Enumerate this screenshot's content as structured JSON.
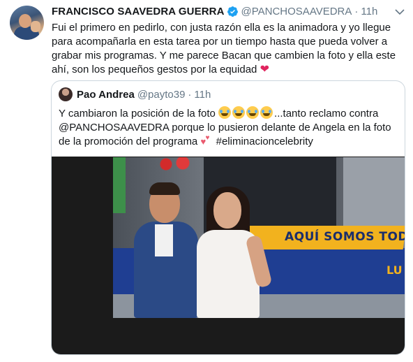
{
  "tweet": {
    "author_name": "FRANCISCO SAAVEDRA GUERRA",
    "handle": "@PANCHOSAAVEDRA",
    "separator": "·",
    "time": "11h",
    "verified_icon": "verified-badge-icon",
    "text_lines": [
      "Fui el primero en pedirlo, con justa razón ella es la animadora y yo llegue",
      "para acompañarla en esta tarea por un tiempo hasta que pueda volver a",
      "grabar mis programas. Y me parece Bacan que cambien la foto y ella este",
      "ahí, son los pequeños gestos por la equidad"
    ],
    "heart_emoji": "❤"
  },
  "quoted_tweet": {
    "author_name": "Pao Andrea",
    "handle": "@payto39",
    "separator": "·",
    "time": "11h",
    "text_line1_prefix": "Y cambiaron la posición de la foto",
    "text_line1_suffix": "...tanto reclamo contra",
    "text_line2": "@PANCHOSAAVEDRA porque lo pusieron delante de Angela en la foto",
    "text_line3_prefix": "de la promoción del programa",
    "text_line3_suffix": "#eliminacioncelebrity",
    "emoji_count": 4
  },
  "media": {
    "tagline": "AQUÍ SOMOS TODOS",
    "corner_text": "LU"
  },
  "colors": {
    "text": "#14171a",
    "secondary": "#657786",
    "verified": "#1da1f2",
    "heart": "#e0245e",
    "border": "#ccd6dd"
  }
}
